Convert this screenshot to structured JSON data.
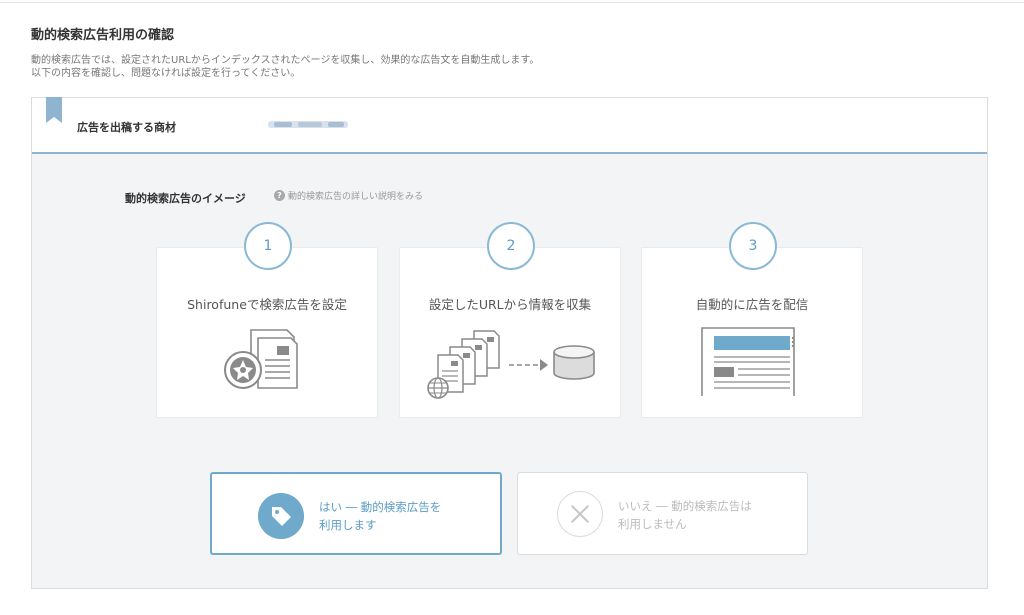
{
  "page": {
    "title": "動的検索広告利用の確認",
    "description_line1": "動的検索広告では、設定されたURLからインデックスされたページを収集し、効果的な広告文を自動生成します。",
    "description_line2": "以下の内容を確認し、問題なければ設定を行ってください。"
  },
  "product": {
    "label": "広告を出稿する商材",
    "value": ""
  },
  "image_section": {
    "title": "動的検索広告のイメージ",
    "help_link": "動的検索広告の詳しい説明をみる",
    "help_icon": "?"
  },
  "steps": [
    {
      "number": "1",
      "label": "Shirofuneで検索広告を設定",
      "icon": "document-with-seal-icon"
    },
    {
      "number": "2",
      "label": "設定したURLから情報を収集",
      "icon": "pages-to-database-icon"
    },
    {
      "number": "3",
      "label": "自動的に広告を配信",
      "icon": "ad-page-icon"
    }
  ],
  "choices": {
    "yes": {
      "line1": "はい ― 動的検索広告を",
      "line2": "利用します",
      "icon": "tag-icon"
    },
    "no": {
      "line1": "いいえ ― 動的検索広告は",
      "line2": "利用しません",
      "icon": "close-icon"
    }
  },
  "colors": {
    "accent": "#6fa9cc",
    "accent_text": "#5a9cc4",
    "panel_bg": "#f2f4f6",
    "disabled_text": "#bbbbbb"
  }
}
